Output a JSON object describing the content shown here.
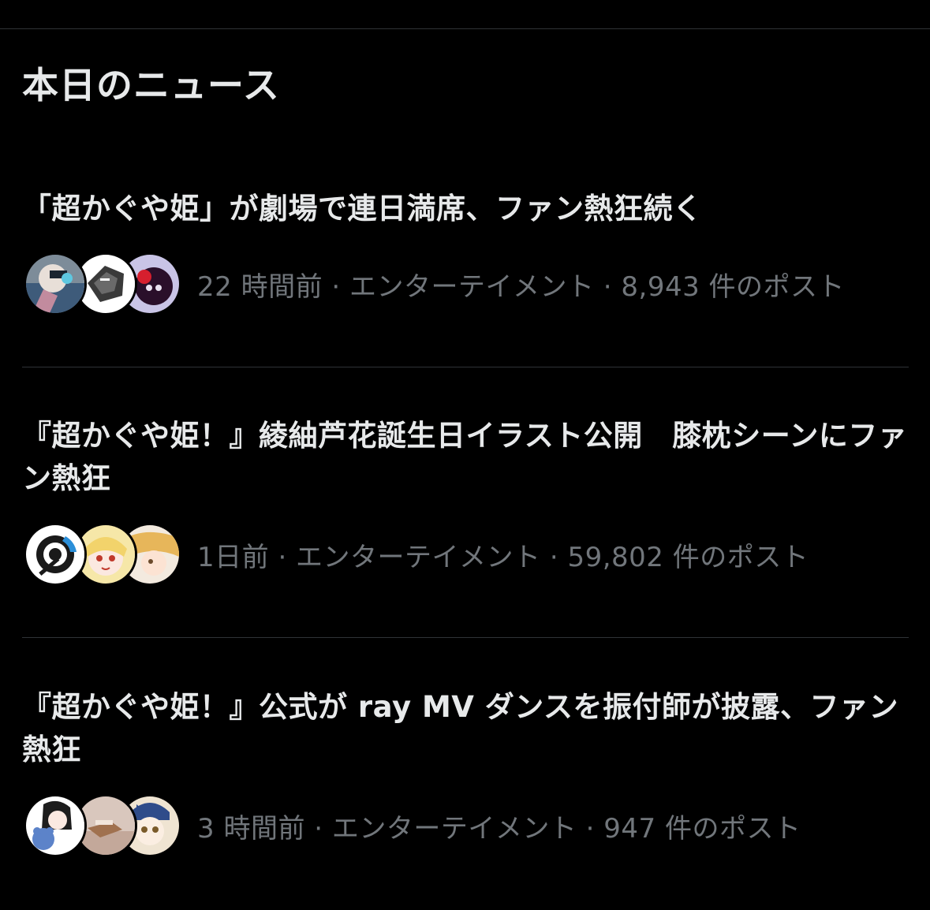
{
  "section": {
    "title": "本日のニュース"
  },
  "news": [
    {
      "headline": "「超かぐや姫」が劇場で連日満席、ファン熱狂続く",
      "meta": "22 時間前 · エンターテイメント · 8,943 件のポスト"
    },
    {
      "headline": "『超かぐや姫！』綾紬芦花誕生日イラスト公開　膝枕シーンにファン熱狂",
      "meta": "1日前 · エンターテイメント · 59,802 件のポスト"
    },
    {
      "headline": "『超かぐや姫！』公式が ray MV ダンスを振付師が披露、ファン熱狂",
      "meta": "3 時間前 · エンターテイメント · 947 件のポスト"
    }
  ],
  "colors": {
    "background": "#000000",
    "text_primary": "#e7e9ea",
    "text_secondary": "#71767b",
    "divider": "#2f3336"
  }
}
